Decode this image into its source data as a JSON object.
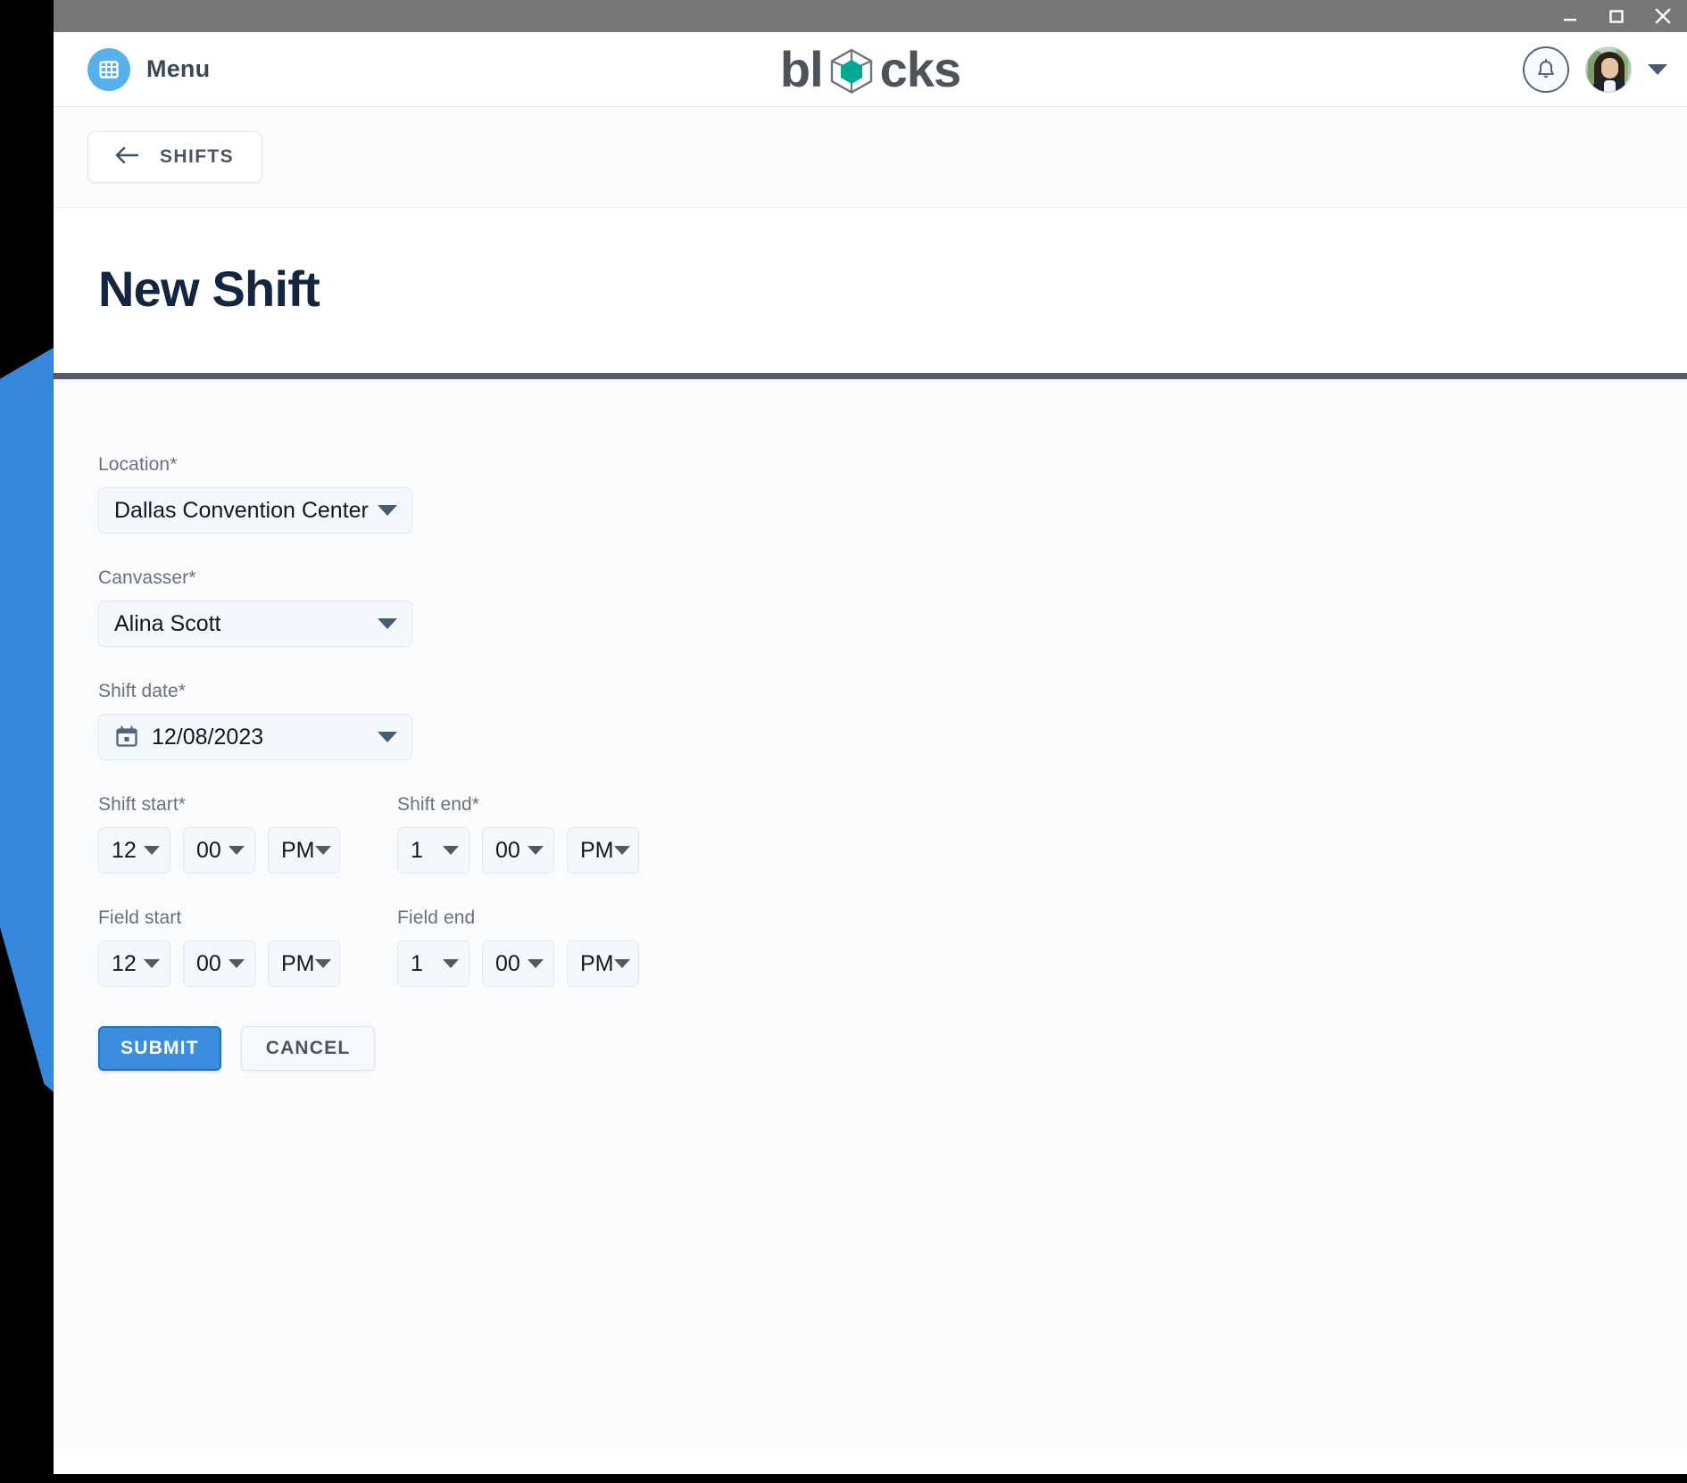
{
  "window_controls": {
    "minimize": "minimize-icon",
    "maximize": "maximize-icon",
    "close": "close-icon"
  },
  "appbar": {
    "menu_label": "Menu",
    "menu_icon": "grid-icon",
    "brand_before": "bl",
    "brand_after": "cks",
    "brand_icon": "cube-icon",
    "brand_color": "#4d5459",
    "cube_color": "#00a991",
    "notification_icon": "bell-icon",
    "avatar": "user-avatar",
    "user_menu_icon": "chevron-down-icon"
  },
  "backbar": {
    "back_icon": "arrow-left-icon",
    "back_label": "SHIFTS"
  },
  "page": {
    "title": "New Shift"
  },
  "form": {
    "location": {
      "label": "Location*",
      "value": "Dallas Convention Center"
    },
    "canvasser": {
      "label": "Canvasser*",
      "value": "Alina Scott"
    },
    "shift_date": {
      "label": "Shift date*",
      "value": "12/08/2023",
      "icon": "calendar-icon"
    },
    "shift_start": {
      "label": "Shift start*",
      "hour": "12",
      "minute": "00",
      "meridiem": "PM"
    },
    "shift_end": {
      "label": "Shift end*",
      "hour": "1",
      "minute": "00",
      "meridiem": "PM"
    },
    "field_start": {
      "label": "Field start",
      "hour": "12",
      "minute": "00",
      "meridiem": "PM"
    },
    "field_end": {
      "label": "Field end",
      "hour": "1",
      "minute": "00",
      "meridiem": "PM"
    },
    "submit_label": "SUBMIT",
    "cancel_label": "CANCEL"
  },
  "colors": {
    "primary_blue": "#3b8ede",
    "menu_blue": "#56b0ed",
    "title_navy": "#14253f",
    "titlebar_gray": "#777777",
    "divider_gray": "#545c68"
  }
}
